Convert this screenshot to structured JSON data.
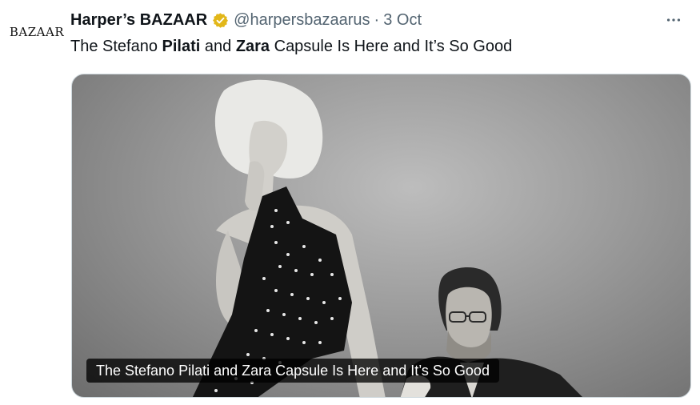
{
  "avatar": {
    "logo_text": "BAZAAR",
    "icon": "publication-logo"
  },
  "header": {
    "display_name": "Harper’s BAZAAR",
    "verified_icon": "verified-badge-icon",
    "verified_color": "#e2b719",
    "handle": "@harpersbazaarus",
    "separator": "·",
    "time": "3 Oct",
    "more_icon": "more-options-icon"
  },
  "tweet": {
    "parts": [
      "The Stefano ",
      "Pilati",
      " and ",
      "Zara",
      " Capsule Is Here and It’s So Good"
    ]
  },
  "media": {
    "card_caption": "The Stefano Pilati and Zara Capsule Is Here and It’s So Good"
  },
  "colors": {
    "text": "#0f1419",
    "secondary": "#536471",
    "border": "#cfd9de"
  }
}
